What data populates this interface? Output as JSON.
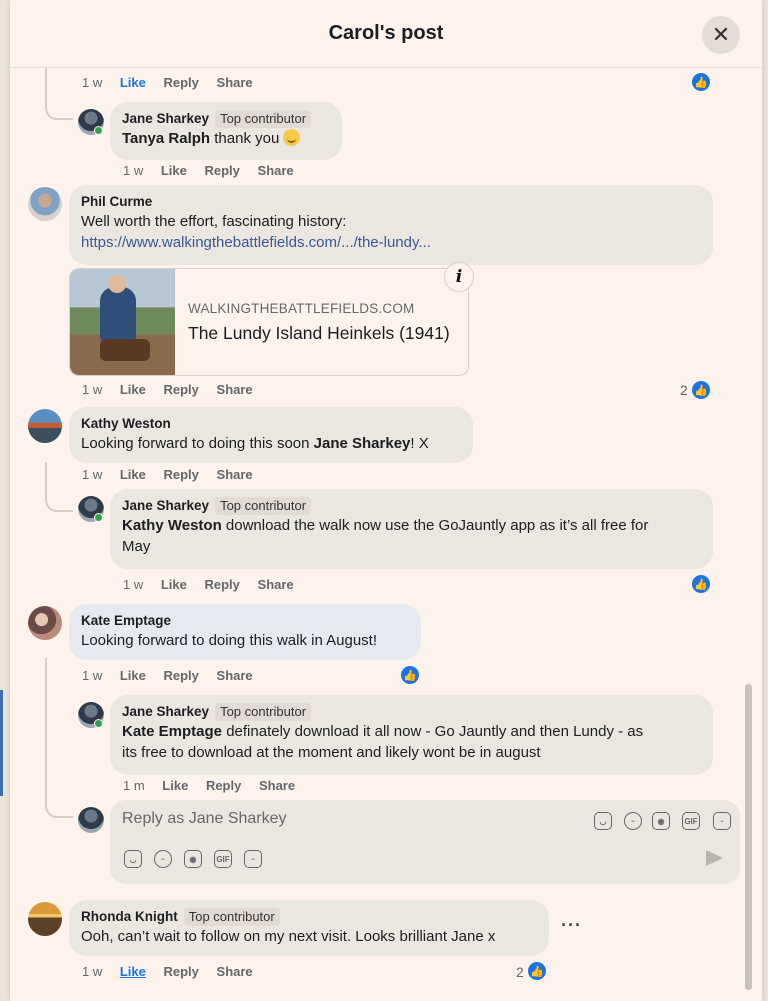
{
  "header": {
    "title": "Carol's post",
    "close_glyph": "✕"
  },
  "badge": "Top contributor",
  "comments": {
    "c0": {
      "actions": {
        "time": "1 w",
        "like": "Like",
        "reply": "Reply",
        "share": "Share"
      }
    },
    "r1": {
      "author": "Jane Sharkey",
      "mention": "Tanya Ralph",
      "text": " thank you ",
      "actions": {
        "time": "1 w",
        "like": "Like",
        "reply": "Reply",
        "share": "Share"
      }
    },
    "c2": {
      "author": "Phil Curme",
      "text": "Well worth the effort, fascinating history:",
      "link": "https://www.walkingthebattlefields.com/.../the-lundy...",
      "card": {
        "domain": "WALKINGTHEBATTLEFIELDS.COM",
        "title": "The Lundy Island Heinkels (1941)",
        "info": "i"
      },
      "actions": {
        "time": "1 w",
        "like": "Like",
        "reply": "Reply",
        "share": "Share"
      },
      "likes": "2"
    },
    "c3": {
      "author": "Kathy Weston",
      "text": "Looking forward to doing this soon ",
      "mention": "Jane Sharkey",
      "text_end": "! X",
      "actions": {
        "time": "1 w",
        "like": "Like",
        "reply": "Reply",
        "share": "Share"
      }
    },
    "r3": {
      "author": "Jane Sharkey",
      "mention": "Kathy Weston",
      "text": " download the walk now use the GoJauntly app as it’s all free for",
      "text2": "May",
      "actions": {
        "time": "1 w",
        "like": "Like",
        "reply": "Reply",
        "share": "Share"
      }
    },
    "c4": {
      "author": "Kate Emptage",
      "text": "Looking forward to doing this walk in August!",
      "actions": {
        "time": "1 w",
        "like": "Like",
        "reply": "Reply",
        "share": "Share"
      }
    },
    "r4": {
      "author": "Jane Sharkey",
      "mention": "Kate Emptage",
      "text": " definately download it all now - Go Jauntly and then Lundy - as",
      "text2": "its free to download at the moment and likely wont be in august",
      "actions": {
        "time": "1 m",
        "like": "Like",
        "reply": "Reply",
        "share": "Share"
      }
    },
    "c5": {
      "author": "Rhonda Knight",
      "text": "Ooh, can’t wait to follow on my next visit. Looks brilliant Jane x",
      "more": "···",
      "actions": {
        "time": "1 w",
        "like": "Like",
        "reply": "Reply",
        "share": "Share"
      },
      "likes": "2"
    }
  },
  "reply_box": {
    "placeholder": "Reply as Jane Sharkey",
    "gif": "GIF"
  },
  "icons": {
    "like": "thumbs-up-icon",
    "close": "close-icon",
    "send": "send-icon"
  },
  "colors": {
    "like_blue": "#1b74e4",
    "link": "#385898",
    "background": "#fdf3ec"
  }
}
